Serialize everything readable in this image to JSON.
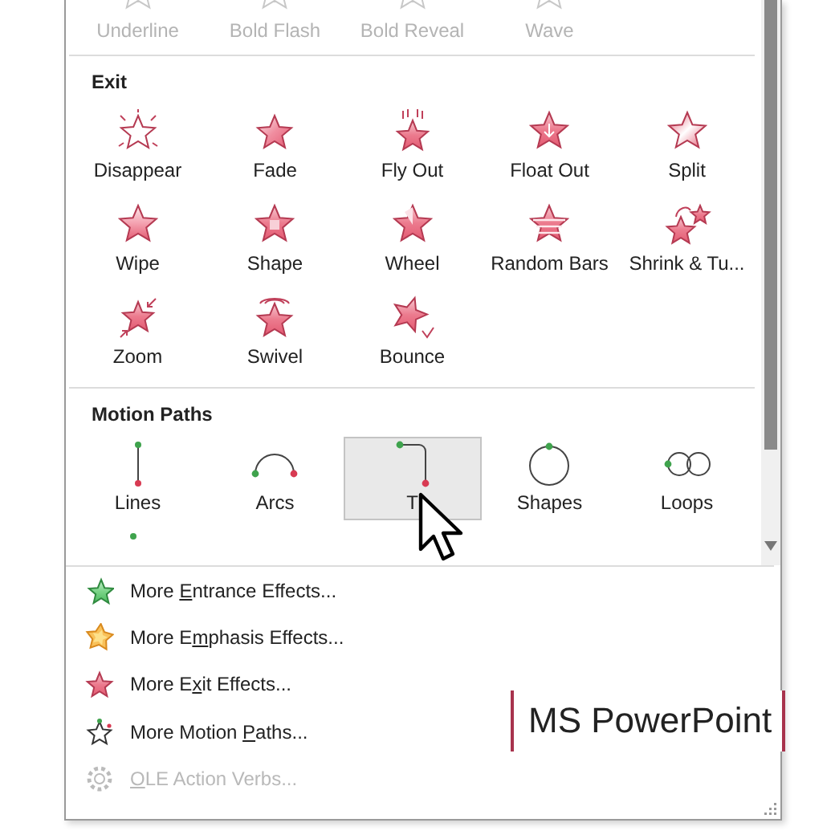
{
  "top_row": [
    {
      "label": "Underline",
      "disabled": true,
      "selected": false
    },
    {
      "label": "Bold Flash",
      "disabled": true,
      "selected": false
    },
    {
      "label": "Bold Reveal",
      "disabled": true,
      "selected": false
    },
    {
      "label": "Wave",
      "disabled": true,
      "selected": false
    }
  ],
  "sections": [
    {
      "title": "Exit",
      "kind": "exit",
      "items": [
        {
          "label": "Disappear",
          "selected": false
        },
        {
          "label": "Fade",
          "selected": false
        },
        {
          "label": "Fly Out",
          "selected": false
        },
        {
          "label": "Float Out",
          "selected": false
        },
        {
          "label": "Split",
          "selected": false
        },
        {
          "label": "Wipe",
          "selected": false
        },
        {
          "label": "Shape",
          "selected": false
        },
        {
          "label": "Wheel",
          "selected": false
        },
        {
          "label": "Random Bars",
          "selected": false
        },
        {
          "label": "Shrink & Tu...",
          "selected": false
        },
        {
          "label": "Zoom",
          "selected": false
        },
        {
          "label": "Swivel",
          "selected": false
        },
        {
          "label": "Bounce",
          "selected": false
        }
      ]
    },
    {
      "title": "Motion Paths",
      "kind": "motion",
      "items": [
        {
          "label": "Lines",
          "selected": false
        },
        {
          "label": "Arcs",
          "selected": false
        },
        {
          "label": "T",
          "selected": true
        },
        {
          "label": "Shapes",
          "selected": false
        },
        {
          "label": "Loops",
          "selected": false
        }
      ]
    }
  ],
  "menu": [
    {
      "before": "More ",
      "key": "E",
      "after": "ntrance Effects...",
      "disabled": false
    },
    {
      "before": "More E",
      "key": "m",
      "after": "phasis Effects...",
      "disabled": false
    },
    {
      "before": "More E",
      "key": "x",
      "after": "it Effects...",
      "disabled": false
    },
    {
      "before": "More Motion ",
      "key": "P",
      "after": "aths...",
      "disabled": false
    },
    {
      "key": "O",
      "after": "LE Action Verbs...",
      "disabled": true
    }
  ],
  "caption": "MS PowerPoint"
}
